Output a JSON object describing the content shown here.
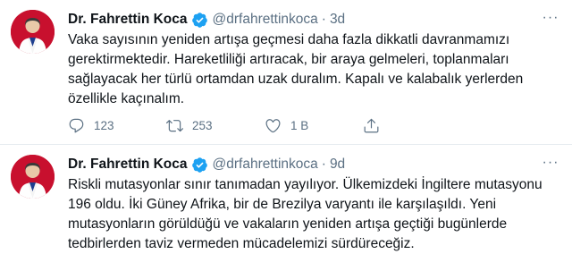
{
  "tweets": [
    {
      "author_name": "Dr. Fahrettin Koca",
      "handle": "@drfahrettinkoca",
      "separator": "·",
      "time": "3d",
      "more_label": "···",
      "lines": [
        "Vaka sayısının yeniden artışa geçmesi daha fazla dikkatli davranmamızı",
        "gerektirmektedir. Hareketliliği artıracak, bir araya gelmeleri, toplanmaları",
        "sağlayacak her türlü ortamdan uzak duralım. Kapalı ve kalabalık yerlerden",
        "özellikle kaçınalım."
      ],
      "replies": "123",
      "retweets": "253",
      "likes": "1 B",
      "icons": [
        "reply-icon",
        "retweet-icon",
        "like-icon",
        "share-icon"
      ]
    },
    {
      "author_name": "Dr. Fahrettin Koca",
      "handle": "@drfahrettinkoca",
      "separator": "·",
      "time": "9d",
      "more_label": "···",
      "lines": [
        "Riskli mutasyonlar sınır tanımadan yayılıyor. Ülkemizdeki İngiltere mutasyonu",
        "196 oldu. İki Güney Afrika, bir de Brezilya varyantı ile karşılaşıldı. Yeni",
        "mutasyonların görüldüğü ve vakaların yeniden artışa geçtiği bugünlerde",
        "tedbirlerden taviz vermeden mücadelemizi sürdüreceğiz."
      ]
    }
  ],
  "colors": {
    "verified": "#1da1f2",
    "muted": "#5b7083",
    "text": "#0f1419",
    "divider": "#e6ecf0",
    "avatar_bg": "#c8102e"
  }
}
